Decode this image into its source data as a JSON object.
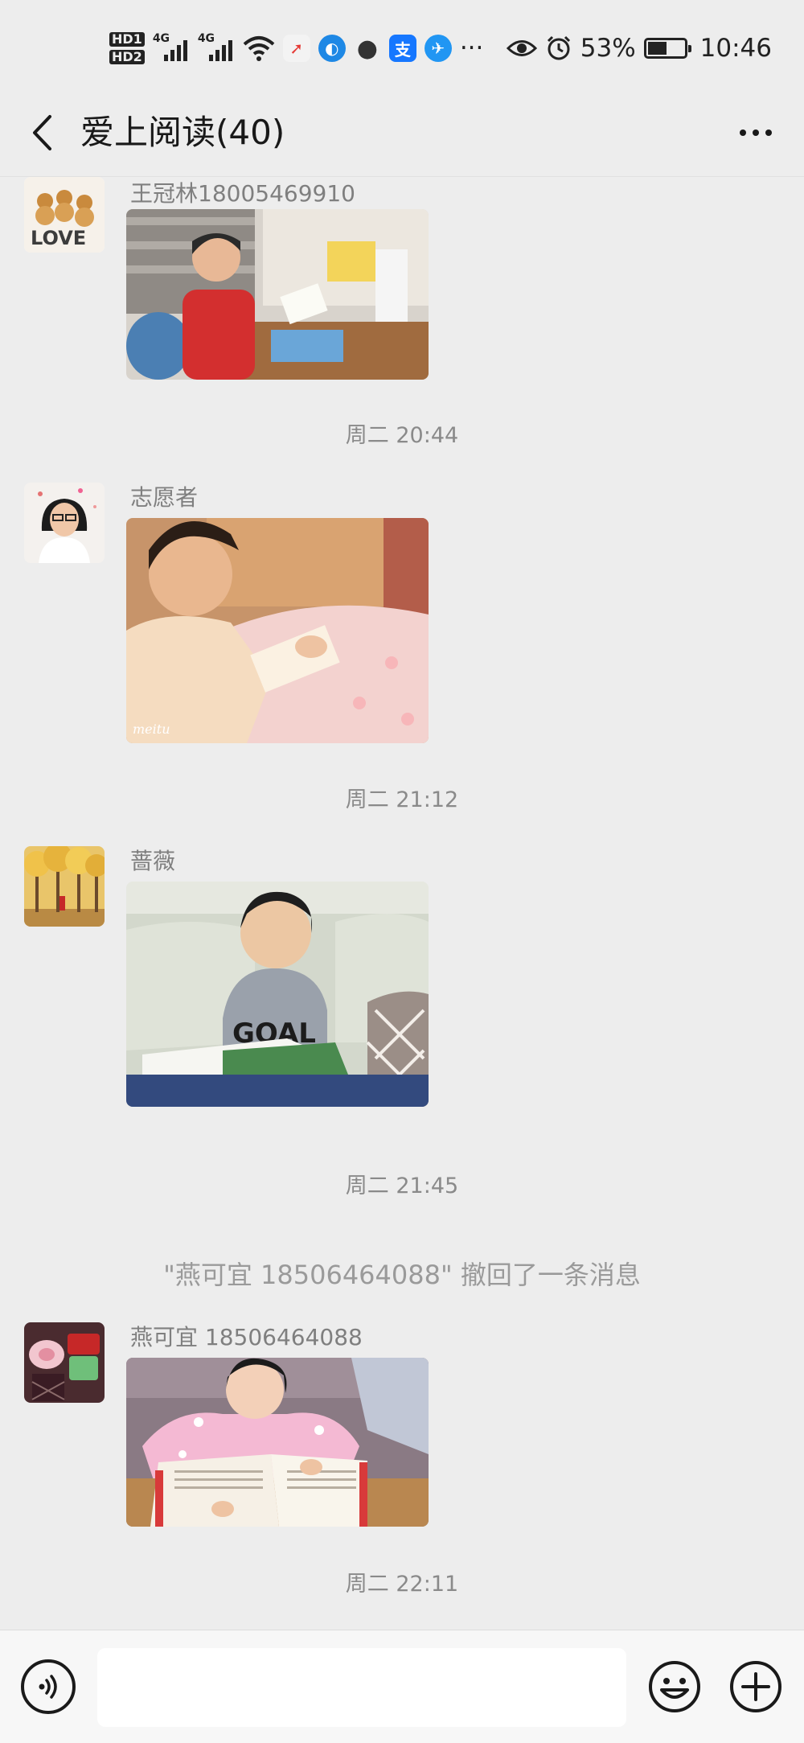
{
  "status_bar": {
    "hd1": "HD1",
    "hd2": "HD2",
    "network_1": "4G",
    "network_2": "4G",
    "battery_percent": "53%",
    "battery_level": 0.53,
    "time": "10:46",
    "icons": [
      "wifi-icon",
      "app-notification-icon",
      "browser-icon",
      "chat-bubble-icon",
      "alipay-icon",
      "vpn-icon",
      "more-notifications-icon",
      "eye-comfort-icon",
      "alarm-icon",
      "battery-icon"
    ]
  },
  "header": {
    "title": "爱上阅读(40)",
    "back_icon": "chevron-left-icon",
    "more_icon": "more-dots-icon"
  },
  "messages": [
    {
      "sender": "王冠林18005469910",
      "avatar": "love-bears-avatar",
      "photo": "boy-red-sweater-reading-at-desk"
    },
    {
      "timestamp": "周二 20:44"
    },
    {
      "sender": "志愿者",
      "avatar": "woman-with-glasses-avatar",
      "photo": "boy-reading-on-bed",
      "photo_watermark": "meitu"
    },
    {
      "timestamp": "周二 21:12"
    },
    {
      "sender": "蔷薇",
      "avatar": "autumn-trees-avatar",
      "photo": "boy-goal-sweater-reading-on-sofa"
    },
    {
      "timestamp": "周二 21:45"
    },
    {
      "system": "\"燕可宜 18506464088\" 撤回了一条消息"
    },
    {
      "sender": "燕可宜 18506464088",
      "avatar": "gift-box-avatar",
      "photo": "girl-reading-book-at-table"
    },
    {
      "timestamp": "周二 22:11"
    }
  ],
  "input_bar": {
    "voice_icon": "voice-icon",
    "input_value": "",
    "emoji_icon": "emoji-icon",
    "plus_icon": "plus-icon"
  }
}
